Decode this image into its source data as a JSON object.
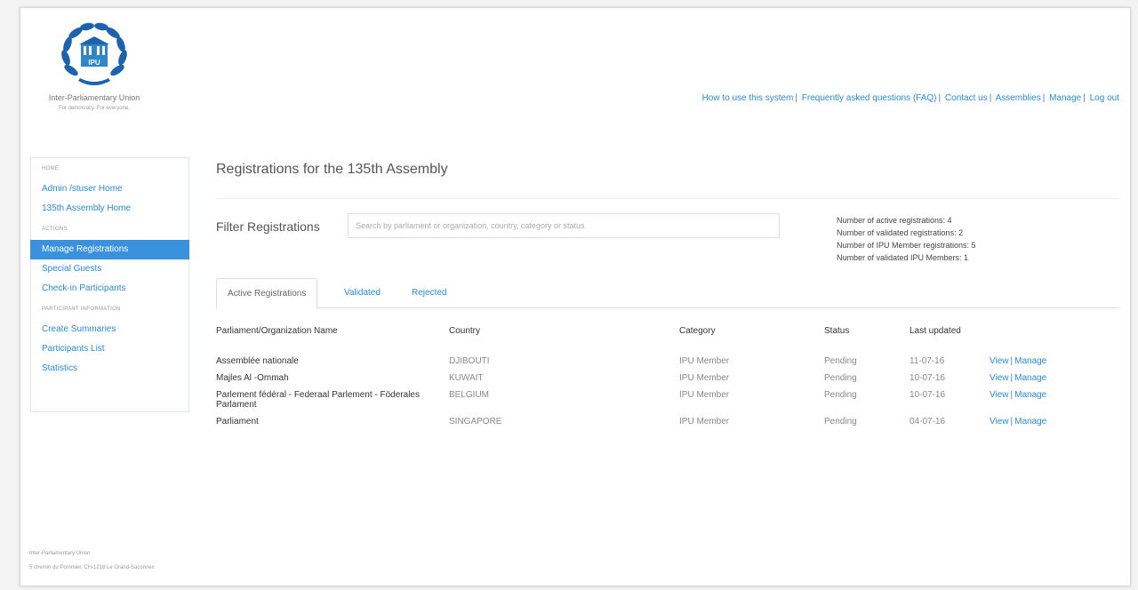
{
  "org": {
    "name": "Inter-Parliamentary Union",
    "tagline": "For democracy. For everyone.",
    "logo_text": "IPU"
  },
  "top_links": [
    "How to use this system",
    "Frequently asked questions (FAQ)",
    "Contact us",
    "Assemblies",
    "Manage",
    "Log out"
  ],
  "sidebar": {
    "sections": [
      {
        "title": "Home",
        "items": [
          {
            "label": "Admin /stuser Home",
            "active": false
          },
          {
            "label": "135th Assembly Home",
            "active": false
          }
        ]
      },
      {
        "title": "Actions",
        "items": [
          {
            "label": "Manage Registrations",
            "active": true
          },
          {
            "label": "Special Guests",
            "active": false
          },
          {
            "label": "Check-in Participants",
            "active": false
          }
        ]
      },
      {
        "title": "Participant Information",
        "items": [
          {
            "label": "Create Summaries",
            "active": false
          },
          {
            "label": "Participants List",
            "active": false
          },
          {
            "label": "Statistics",
            "active": false
          }
        ]
      }
    ]
  },
  "main": {
    "title": "Registrations for the 135th Assembly",
    "filter_label": "Filter Registrations",
    "filter_placeholder": "Search by parliament or organization, country, category or status",
    "stats": [
      "Number of active registrations: 4",
      "Number of validated registrations: 2",
      "Number of IPU Member registrations: 5",
      "Number of validated IPU Members: 1"
    ],
    "tabs": [
      {
        "label": "Active Registrations",
        "active": true
      },
      {
        "label": "Validated",
        "active": false
      },
      {
        "label": "Rejected",
        "active": false
      }
    ],
    "columns": [
      "Parliament/Organization Name",
      "Country",
      "Category",
      "Status",
      "Last updated"
    ],
    "rows": [
      {
        "name": "Assemblée nationale",
        "country": "DJIBOUTI",
        "category": "IPU Member",
        "status": "Pending",
        "updated": "11-07-16"
      },
      {
        "name": "Majles Al -Ommah",
        "country": "KUWAIT",
        "category": "IPU Member",
        "status": "Pending",
        "updated": "10-07-16"
      },
      {
        "name": "Parlement fédéral - Federaal Parlement - Föderales Parlament",
        "country": "BELGIUM",
        "category": "IPU Member",
        "status": "Pending",
        "updated": "10-07-16"
      },
      {
        "name": "Parliament",
        "country": "SINGAPORE",
        "category": "IPU Member",
        "status": "Pending",
        "updated": "04-07-16"
      }
    ],
    "row_actions": {
      "view": "View",
      "manage": "Manage"
    }
  },
  "footer": {
    "line1": "Inter-Parliamentary Union",
    "line2": "5 chemin du Pommier, CH-1218 Le Grand-Saconnex"
  },
  "colors": {
    "link": "#2a8bd8",
    "active_nav": "#3a92de",
    "logo_blue": "#1d62ad"
  }
}
